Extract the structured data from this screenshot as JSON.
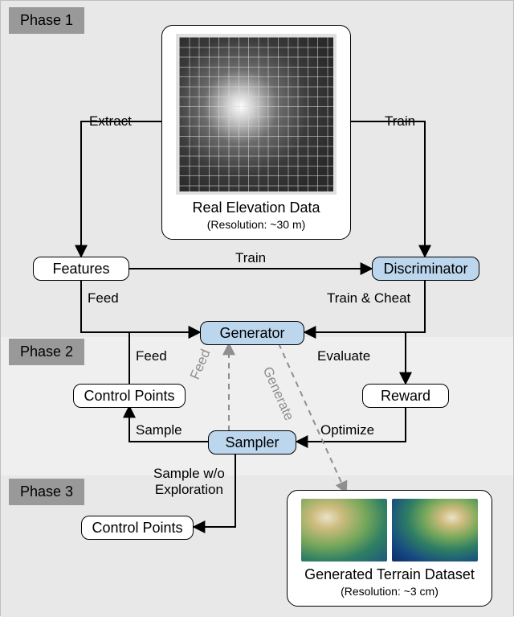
{
  "phases": {
    "p1": "Phase 1",
    "p2": "Phase 2",
    "p3": "Phase 3"
  },
  "nodes": {
    "elevation_caption": "Real Elevation Data",
    "elevation_sub": "(Resolution: ~30 m)",
    "features": "Features",
    "discriminator": "Discriminator",
    "generator": "Generator",
    "control_points_1": "Control Points",
    "reward": "Reward",
    "sampler": "Sampler",
    "control_points_2": "Control Points",
    "generated_caption": "Generated Terrain Dataset",
    "generated_sub": "(Resolution: ~3 cm)"
  },
  "edges": {
    "extract": "Extract",
    "train_top": "Train",
    "train_mid": "Train",
    "feed_left": "Feed",
    "train_cheat": "Train & Cheat",
    "feed_p2": "Feed",
    "evaluate": "Evaluate",
    "sample": "Sample",
    "optimize": "Optimize",
    "feed_dashed": "Feed",
    "generate_dashed": "Generate",
    "sample_wo": "Sample w/o\nExploration"
  },
  "colors": {
    "node_blue": "#bcd6ee",
    "phase_label_bg": "#999999",
    "edge": "#000000",
    "edge_dashed": "#8f8f8f"
  }
}
